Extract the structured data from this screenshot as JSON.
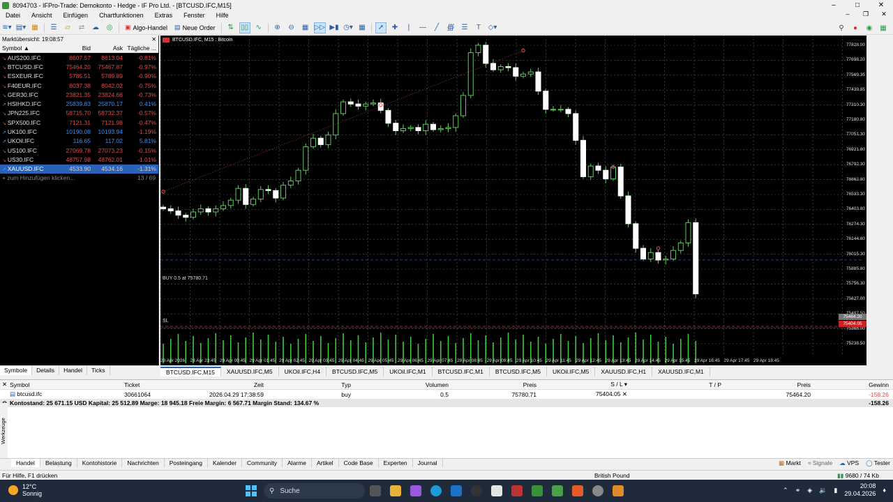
{
  "window": {
    "title": "8094703 - IFPro-Trade: Demokonto - Hedge - IF Pro Ltd. - [BTCUSD.IFC,M15]"
  },
  "menu": [
    "Datei",
    "Ansicht",
    "Einfügen",
    "Chartfunktionen",
    "Extras",
    "Fenster",
    "Hilfe"
  ],
  "toolbar": {
    "algo_label": "Algo-Handel",
    "neworder_label": "Neue Order"
  },
  "market_watch": {
    "title": "Marktübersicht: 19:08:57",
    "columns": {
      "symbol": "Symbol",
      "bid": "Bid",
      "ask": "Ask",
      "change": "Tägliche ..."
    },
    "rows": [
      {
        "symbol": "AUS200.IFC",
        "bid": "8607.57",
        "ask": "8613.04",
        "change": "-0.81%",
        "dir": "down"
      },
      {
        "symbol": "BTCUSD.IFC",
        "bid": "75464.20",
        "ask": "75467.87",
        "change": "-0.97%",
        "dir": "down"
      },
      {
        "symbol": "ESXEUR.IFC",
        "bid": "5785.51",
        "ask": "5789.89",
        "change": "-0.90%",
        "dir": "down"
      },
      {
        "symbol": "F40EUR.IFC",
        "bid": "8037.38",
        "ask": "8042.02",
        "change": "-0.75%",
        "dir": "down"
      },
      {
        "symbol": "GER30.IFC",
        "bid": "23821.35",
        "ask": "23824.66",
        "change": "-0.73%",
        "dir": "down"
      },
      {
        "symbol": "HSIHKD.IFC",
        "bid": "25839.83",
        "ask": "25870.17",
        "change": "0.41%",
        "dir": "up"
      },
      {
        "symbol": "JPN225.IFC",
        "bid": "58715.70",
        "ask": "58732.37",
        "change": "-0.57%",
        "dir": "down"
      },
      {
        "symbol": "SPX500.IFC",
        "bid": "7121.31",
        "ask": "7121.98",
        "change": "-0.47%",
        "dir": "down"
      },
      {
        "symbol": "UK100.IFC",
        "bid": "10190.08",
        "ask": "10193.94",
        "change": "-1.19%",
        "dir": "up"
      },
      {
        "symbol": "UKOil.IFC",
        "bid": "116.65",
        "ask": "117.02",
        "change": "5.81%",
        "dir": "up"
      },
      {
        "symbol": "US100.IFC",
        "bid": "27069.78",
        "ask": "27073.23",
        "change": "-0.15%",
        "dir": "down"
      },
      {
        "symbol": "US30.IFC",
        "bid": "48757.98",
        "ask": "48762.01",
        "change": "-1.01%",
        "dir": "down"
      },
      {
        "symbol": "XAUUSD.IFC",
        "bid": "4533.90",
        "ask": "4534.16",
        "change": "-1.31%",
        "dir": "up",
        "selected": true
      }
    ],
    "add_label": "+ zum Hinzufügen klicken...",
    "count": "13 / 69",
    "tabs": [
      "Symbole",
      "Details",
      "Handel",
      "Ticks"
    ]
  },
  "chart": {
    "title": "BTCUSD.IFC, M15 : Bitcoin",
    "buy_label": "BUY 0.5 at 75780.71",
    "sl_label": "SL",
    "price_ticks": [
      "77828.00",
      "77698.20",
      "77569.35",
      "77439.85",
      "77310.30",
      "77180.80",
      "77051.30",
      "76921.80",
      "76792.30",
      "76662.80",
      "76533.30",
      "76403.80",
      "76274.30",
      "76144.80",
      "76015.30",
      "75885.80",
      "75756.30",
      "75627.00",
      "75497.50",
      "75368.00",
      "75238.50"
    ],
    "bid_box": "75464.20",
    "sl_box": "75404.05",
    "time_ticks": [
      "28 Apr 2026",
      "28 Apr 23:45",
      "29 Apr 00:45",
      "29 Apr 01:45",
      "29 Apr 02:45",
      "29 Apr 03:45",
      "29 Apr 04:45",
      "29 Apr 05:45",
      "29 Apr 06:45",
      "29 Apr 07:45",
      "29 Apr 08:45",
      "29 Apr 09:45",
      "29 Apr 10:45",
      "29 Apr 11:45",
      "29 Apr 12:45",
      "29 Apr 13:45",
      "29 Apr 14:45",
      "29 Apr 15:45",
      "29 Apr 16:45",
      "29 Apr 17:45",
      "29 Apr 18:45"
    ],
    "tabs": [
      "BTCUSD.IFC,M15",
      "XAUUSD.IFC,M5",
      "UKOil.IFC,H4",
      "BTCUSD.IFC,M5",
      "UKOil.IFC,M1",
      "BTCUSD.IFC,M1",
      "BTCUSD.IFC,M5",
      "UKOil.IFC,M5",
      "XAUUSD.IFC,H1",
      "XAUUSD.IFC,M1"
    ]
  },
  "chart_data": {
    "type": "candlestick",
    "symbol": "BTCUSD.IFC",
    "timeframe": "M15",
    "ylim": [
      75238.5,
      77828.0
    ],
    "close_path": [
      76260,
      76240,
      76200,
      76180,
      76230,
      76260,
      76230,
      76260,
      76290,
      76340,
      76450,
      76300,
      76350,
      76440,
      76430,
      76360,
      76480,
      76520,
      76620,
      76840,
      76920,
      76860,
      76950,
      77150,
      77260,
      77240,
      77220,
      77240,
      77250,
      77180,
      77060,
      76990,
      77010,
      77020,
      76990,
      77050,
      77000,
      77010,
      77020,
      77130,
      77320,
      77720,
      77790,
      77620,
      77560,
      77590,
      77580,
      77500,
      77520,
      77540,
      77360,
      77190,
      77190,
      77190,
      77150,
      76900,
      76560,
      76660,
      76620,
      76540,
      76650,
      76380,
      76120,
      75890,
      75790,
      75850,
      75780,
      75790,
      75870,
      75940,
      76130,
      75464
    ]
  },
  "terminal": {
    "columns": [
      "Symbol",
      "Ticket",
      "Zeit",
      "Typ",
      "Volumen",
      "Preis",
      "S / L",
      "T / P",
      "Preis",
      "Gewinn"
    ],
    "row": {
      "symbol": "btcusd.ifc",
      "ticket": "30661064",
      "time": "2026.04.29 17:38:59",
      "type": "buy",
      "volume": "0.5",
      "price": "75780.71",
      "sl": "75404.05",
      "tp": "",
      "cur_price": "75464.20",
      "profit": "-158.26"
    },
    "summary": "Kontostand: 25 671.15 USD  Kapital: 25 512.89  Marge: 18 945.18  Freie Margin: 6 567.71  Margin Stand: 134.67 %",
    "summary_profit": "-158.26",
    "vtab": "Werkzeuge",
    "tabs": [
      "Handel",
      "Belastung",
      "Kontohistorie",
      "Nachrichten",
      "Posteingang",
      "Kalender",
      "Community",
      "Alarme",
      "Artikel",
      "Code Base",
      "Experten",
      "Journal"
    ],
    "right_items": [
      "Markt",
      "Signale",
      "VPS",
      "Tester"
    ]
  },
  "status": {
    "help": "Für Hilfe, F1 drücken",
    "currency": "British Pound",
    "connection": "9680 / 74 Kb"
  },
  "taskbar": {
    "temp": "12°C",
    "weather": "Sonnig",
    "search": "Suche",
    "time": "20:08",
    "date": "29.04.2026"
  }
}
